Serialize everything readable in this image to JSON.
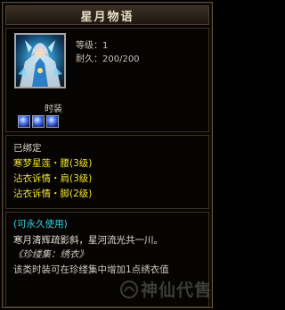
{
  "title": "星月物语",
  "stats": {
    "level": "等级：1",
    "durability": "耐久：200/200"
  },
  "item_type": "时装",
  "gems": [
    "blue-gem-icon",
    "blue-gem-icon",
    "blue-gem-icon"
  ],
  "binding": {
    "status": "已绑定",
    "set_items": [
      "寒梦星莲・腰(3级)",
      "沾衣诉情・肩(3级)",
      "沾衣诉情・脚(2级)"
    ]
  },
  "description": {
    "usage": "(可永久使用)",
    "flavor": "寒月清辉疏影斜，星河流光共一川。",
    "collection": "《珍缕集：绣衣》",
    "note": "该类时装可在珍缕集中增加1点绣衣值"
  },
  "watermark": "神仙代售",
  "colors": {
    "set_item": "#f1e22a",
    "usage": "#2fd4e6",
    "border": "#5f4f33"
  }
}
